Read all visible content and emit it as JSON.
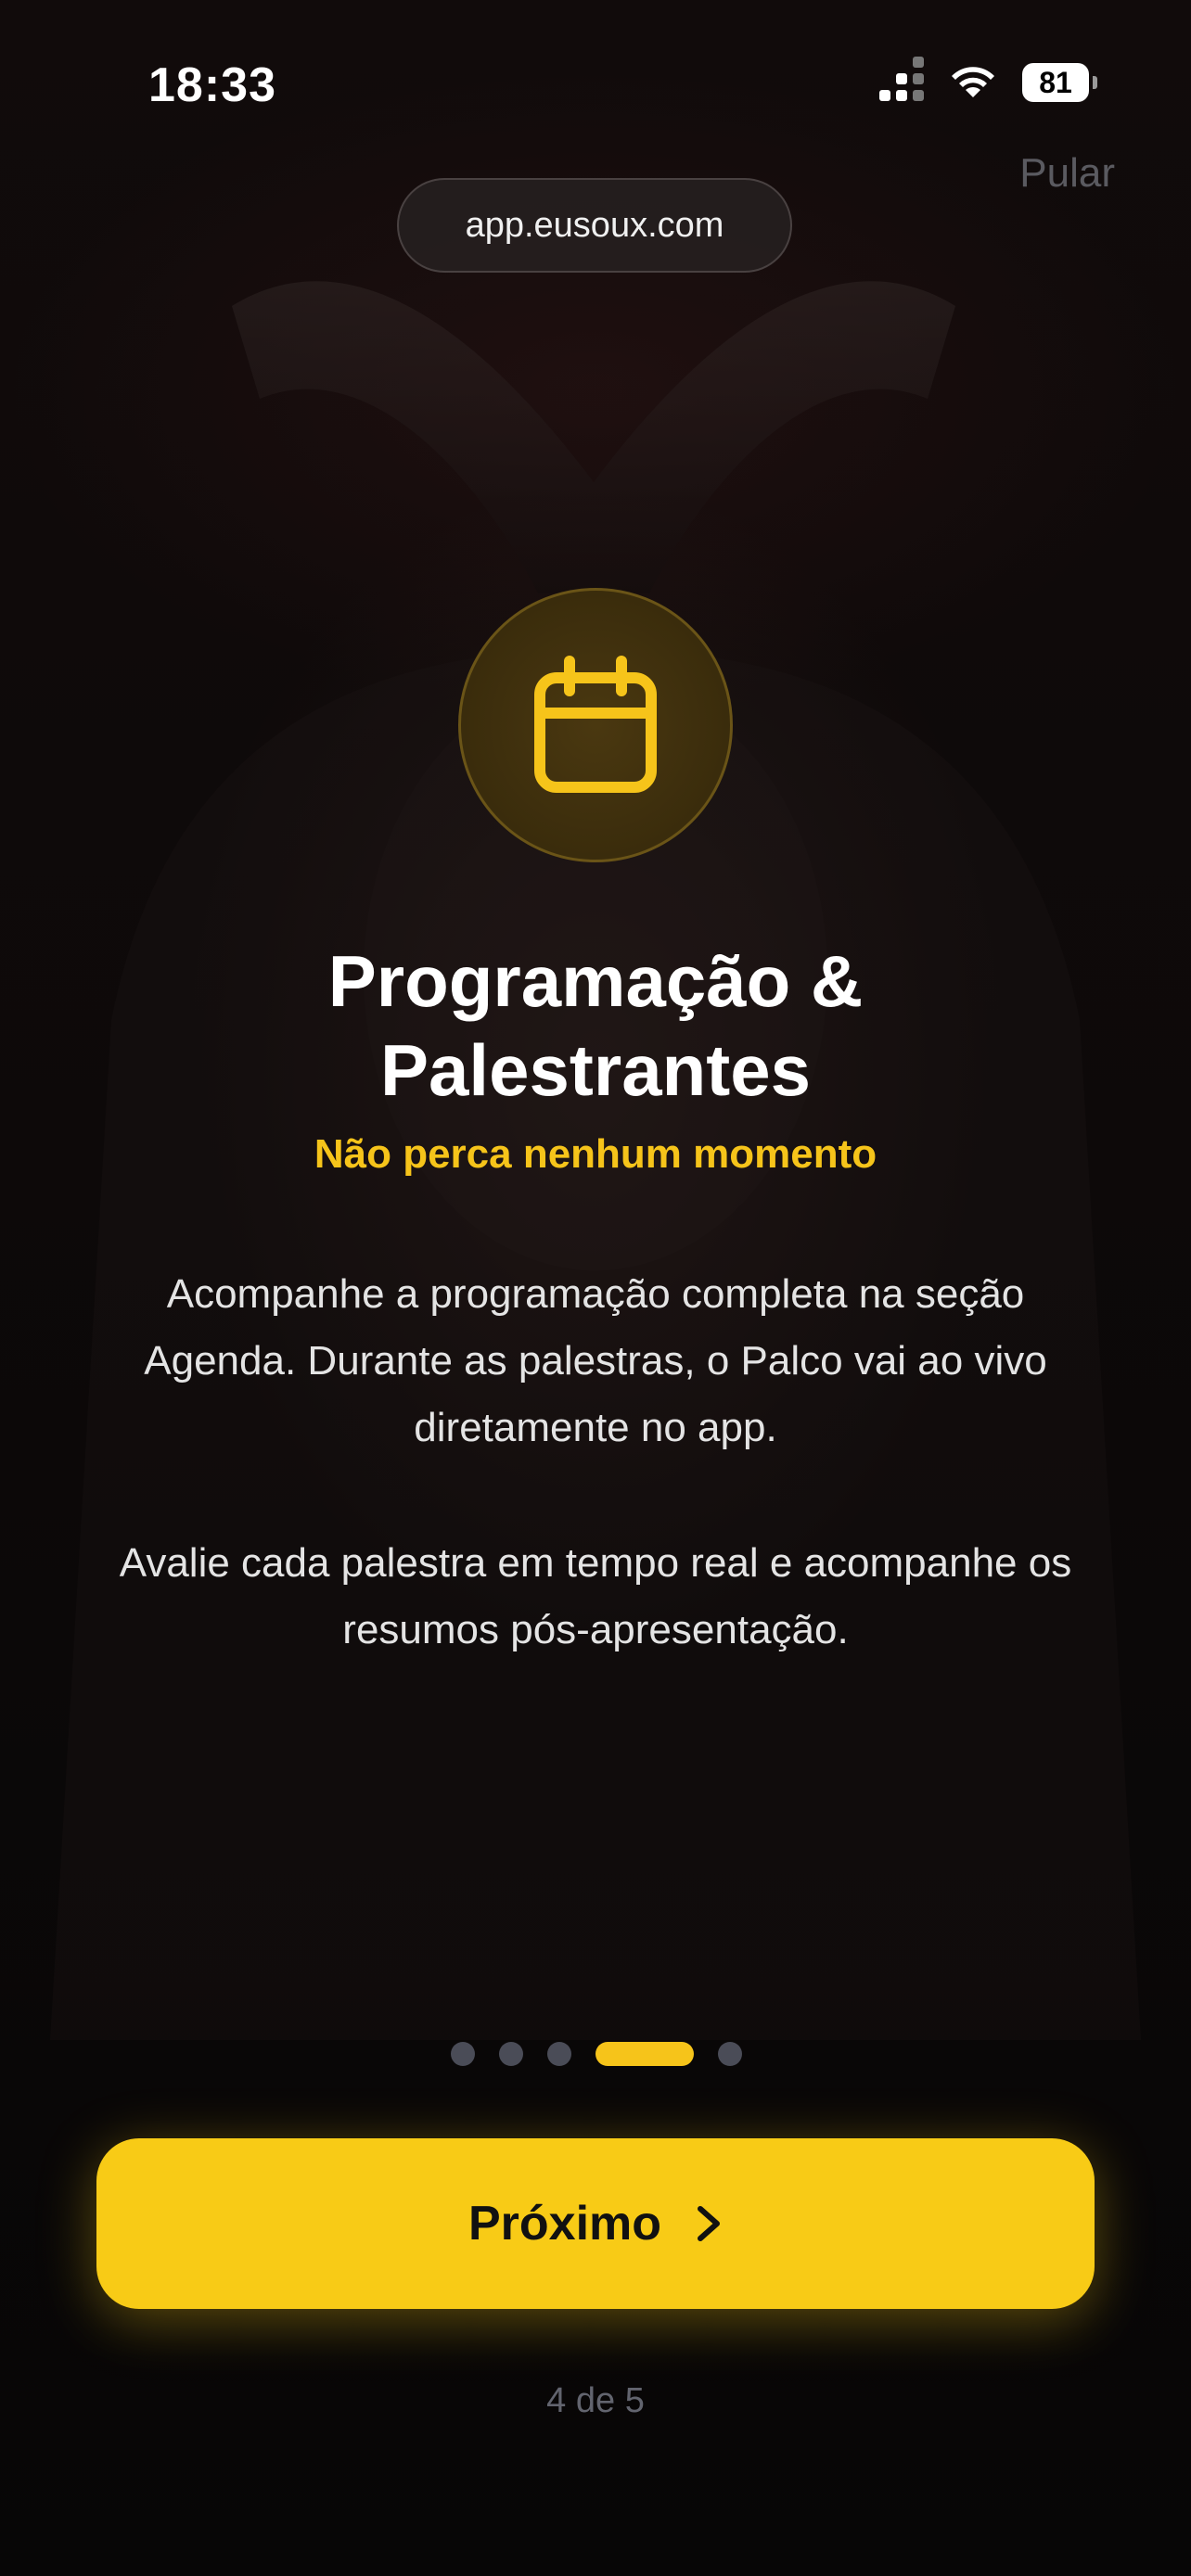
{
  "status_bar": {
    "time": "18:33",
    "battery": "81",
    "icons": [
      "cellular-signal-icon",
      "wifi-icon",
      "battery-icon"
    ]
  },
  "header": {
    "url": "app.eusoux.com",
    "skip_label": "Pular"
  },
  "feature": {
    "icon": "calendar-icon",
    "title_line1": "Programação &",
    "title_line2": "Palestrantes",
    "subtitle": "Não perca nenhum momento",
    "paragraph1": "Acompanhe a programação completa na seção Agenda. Durante as palestras, o Palco vai ao vivo diretamente no app.",
    "paragraph2": "Avalie cada palestra em tempo real e acompanhe os resumos pós-apresentação."
  },
  "pager": {
    "total": 5,
    "current": 4
  },
  "footer": {
    "next_label": "Próximo",
    "step_text": "4 de 5"
  },
  "colors": {
    "accent": "#F8CB16",
    "background": "#0B0909",
    "muted_text": "#62646E"
  }
}
